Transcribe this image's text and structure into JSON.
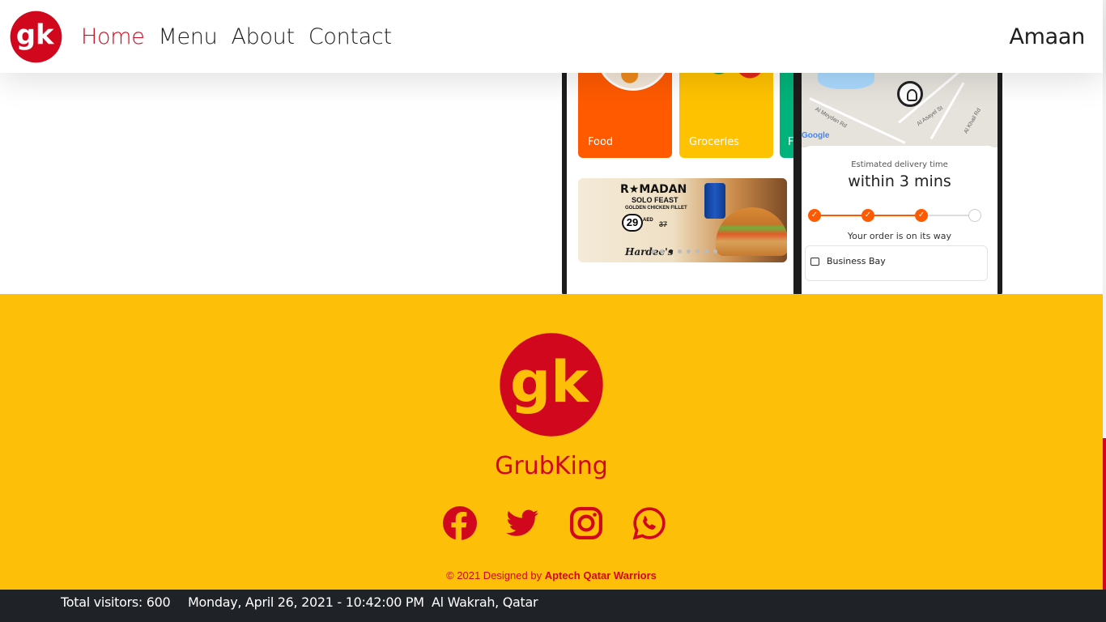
{
  "nav": {
    "links": [
      {
        "label": "Home",
        "active": true
      },
      {
        "label": "Menu",
        "active": false
      },
      {
        "label": "About",
        "active": false
      },
      {
        "label": "Contact",
        "active": false
      }
    ],
    "user": "Amaan",
    "logo_text": "gk"
  },
  "hero": {
    "phone1": {
      "tiles": [
        "Food",
        "Groceries",
        "F"
      ],
      "banner": {
        "title": "R★MADAN",
        "subtitle": "SOLO FEAST",
        "subtitle2": "GOLDEN CHICKEN FILLET",
        "price": "29",
        "price_unit": "AED",
        "old_price": "37",
        "brand": "Hardee's"
      }
    },
    "phone2": {
      "map_labels": [
        "Al Meydan Rd",
        "Al Asayel St",
        "Al Khail Rd"
      ],
      "google_label": "Google",
      "estimate_label": "Estimated delivery time",
      "estimate_value": "within 3 mins",
      "status": "Your order is on its way",
      "address": "Business Bay",
      "progress_steps_done": 3,
      "progress_steps_total": 4
    }
  },
  "footer": {
    "brand": "GrubKing",
    "logo_text": "gk",
    "socials": [
      "facebook-icon",
      "twitter-icon",
      "instagram-icon",
      "whatsapp-icon"
    ],
    "copyright_prefix": "© 2021 Designed by ",
    "copyright_team": "Aptech Qatar Warriors"
  },
  "statusbar": {
    "visitors": "Total visitors: 600",
    "datetime": "Monday, April 26, 2021 - 10:42:00 PM",
    "location": "Al Wakrah, Qatar"
  },
  "colors": {
    "brand_red": "#d1081d",
    "brand_yellow": "#fdbf07",
    "status_bg": "#1f2327"
  }
}
